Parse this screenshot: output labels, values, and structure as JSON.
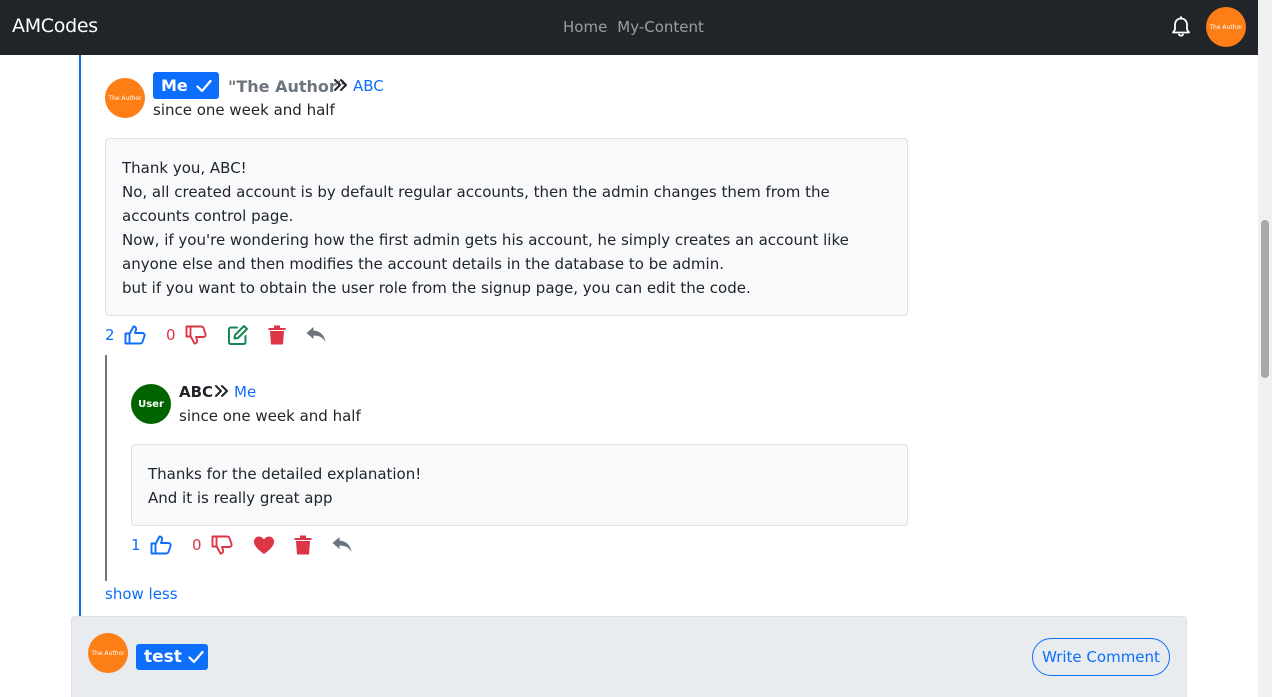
{
  "navbar": {
    "brand": "AMCodes",
    "links": [
      "Home",
      "My-Content"
    ],
    "avatar_text": "The Author"
  },
  "comment": {
    "avatar_text": "The Author",
    "badge": "Me",
    "author": "\"The Author\"",
    "reply_to": "ABC",
    "since": "since one week and half",
    "body": [
      "Thank you, ABC!",
      "No, all created account is by default regular accounts, then the admin changes them from the accounts control page.",
      "Now, if you're wondering how the first admin gets his account, he simply creates an account like anyone else and then modifies the account details in the database to be admin.",
      "but if you want to obtain the user role from the signup page, you can edit the code."
    ],
    "likes": "2",
    "dislikes": "0"
  },
  "reply": {
    "avatar_text": "User",
    "author": "ABC",
    "reply_to": "Me",
    "since": "since one week and half",
    "body": [
      "Thanks for the detailed explanation!",
      "And it is really great app"
    ],
    "likes": "1",
    "dislikes": "0"
  },
  "show_less": "show less",
  "footer": {
    "avatar_text": "The Author",
    "badge": "test",
    "write_comment": "Write Comment"
  },
  "colors": {
    "primary": "#0d6efd",
    "danger": "#dc3545",
    "success": "#198754",
    "secondary": "#6c757d",
    "avatar_orange": "#fd7e14",
    "avatar_green": "#006400",
    "navbar_bg": "#212529"
  },
  "icons": [
    "bell-icon",
    "check-icon",
    "chevrons-right-icon",
    "thumbs-up-icon",
    "thumbs-down-icon",
    "edit-icon",
    "trash-icon",
    "reply-icon",
    "heart-icon"
  ]
}
